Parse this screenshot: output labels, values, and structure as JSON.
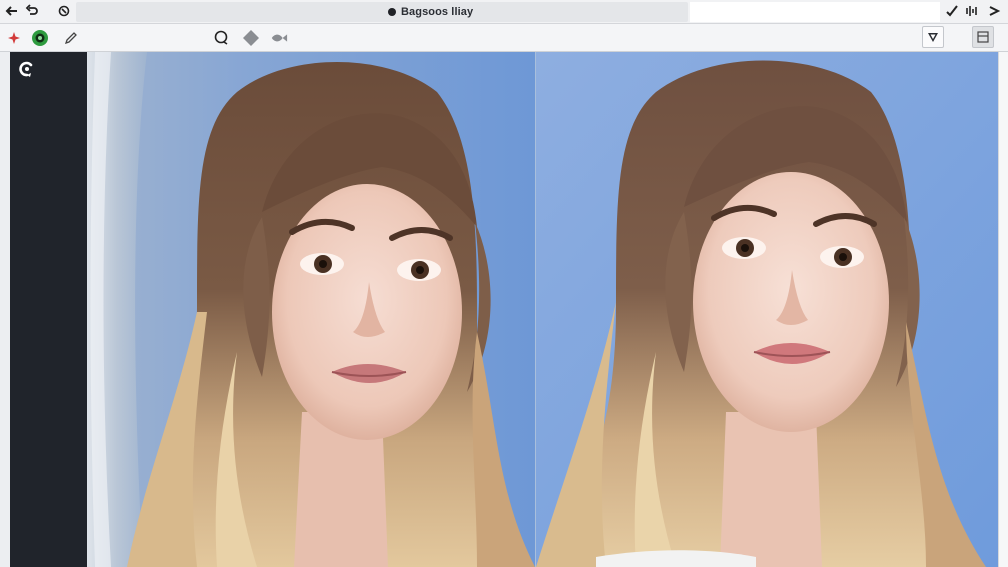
{
  "window": {
    "title": "Bagsoos lliay"
  },
  "titlebar": {
    "left_icons": [
      "back-arrow-icon",
      "undo-icon",
      "hash-icon"
    ],
    "right_icons": [
      "check-icon",
      "waveform-icon",
      "forward-icon"
    ]
  },
  "toolbar": {
    "left_icons": [
      "sparkle-icon",
      "green-circle-icon",
      "pen-icon"
    ],
    "center_icons": [
      "lasso-icon",
      "diamond-icon",
      "fish-icon"
    ],
    "right_icons": [
      "shield-icon",
      "panel-toggle-icon"
    ],
    "accent_green": "#2e9b3f",
    "accent_red": "#d23a3a"
  },
  "sidebar": {
    "logo_icon": "swirl-logo-icon",
    "background": "#20242b"
  },
  "viewer": {
    "panes": [
      "original-portrait",
      "edited-portrait"
    ],
    "sky_color": "#7fa3d4"
  }
}
